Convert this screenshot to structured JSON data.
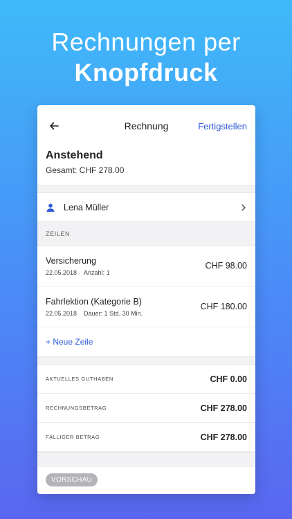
{
  "hero": {
    "line1": "Rechnungen per",
    "line2": "Knopfdruck"
  },
  "navbar": {
    "title": "Rechnung",
    "done_label": "Fertigstellen"
  },
  "summary": {
    "title": "Anstehend",
    "total": "Gesamt: CHF 278.00"
  },
  "customer": {
    "name": "Lena Müller"
  },
  "lines": {
    "section_label": "ZEILEN",
    "items": [
      {
        "title": "Versicherung",
        "date": "22.05.2018",
        "detail": "Anzahl: 1",
        "amount": "CHF 98.00"
      },
      {
        "title": "Fahrlektion (Kategorie B)",
        "date": "22.05.2018",
        "detail": "Dauer: 1 Std. 30 Min.",
        "amount": "CHF 180.00"
      }
    ],
    "add_label": "+ Neue Zeile"
  },
  "totals": [
    {
      "label": "AKTUELLES GUTHABEN",
      "value": "CHF 0.00"
    },
    {
      "label": "RECHNUNGSBETRAG",
      "value": "CHF 278.00"
    },
    {
      "label": "FÄLLIGER BETRAG",
      "value": "CHF 278.00"
    }
  ],
  "footer": {
    "preview_label": "VORSCHAU"
  },
  "colors": {
    "accent": "#2f5bd6",
    "bg_top": "#3fbaf9",
    "bg_bottom": "#5a66f0"
  },
  "icons": {
    "back": "arrow-left-icon",
    "person": "person-icon",
    "chevron": "chevron-right-icon"
  }
}
